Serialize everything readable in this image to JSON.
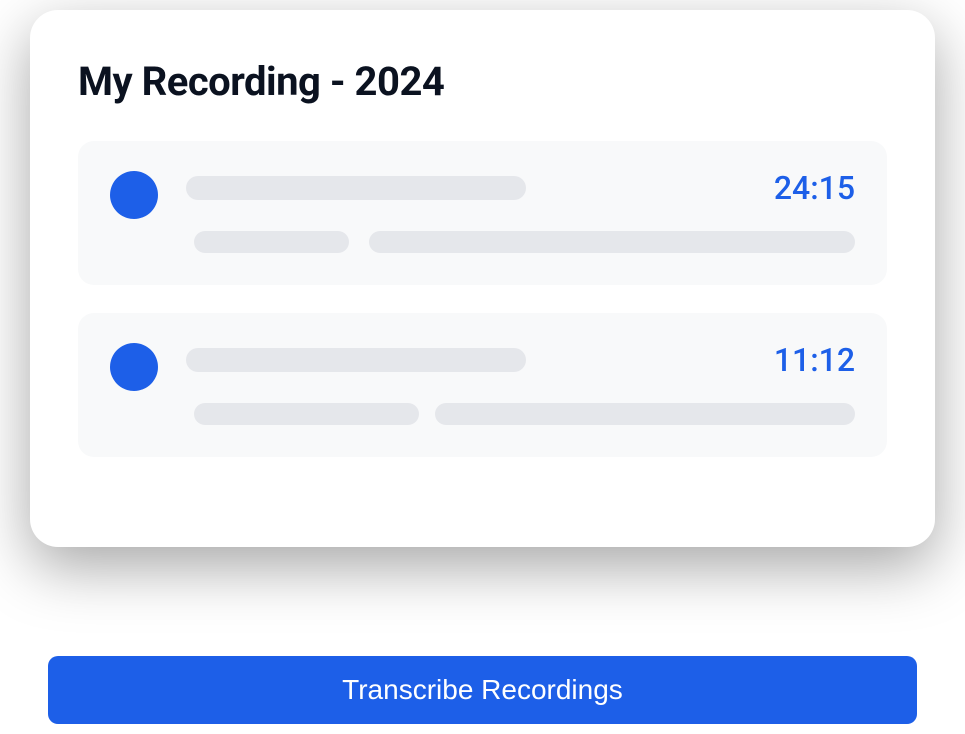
{
  "title": "My Recording - 2024",
  "recordings": [
    {
      "duration": "24:15"
    },
    {
      "duration": "11:12"
    }
  ],
  "actions": {
    "transcribe_label": "Transcribe Recordings"
  }
}
